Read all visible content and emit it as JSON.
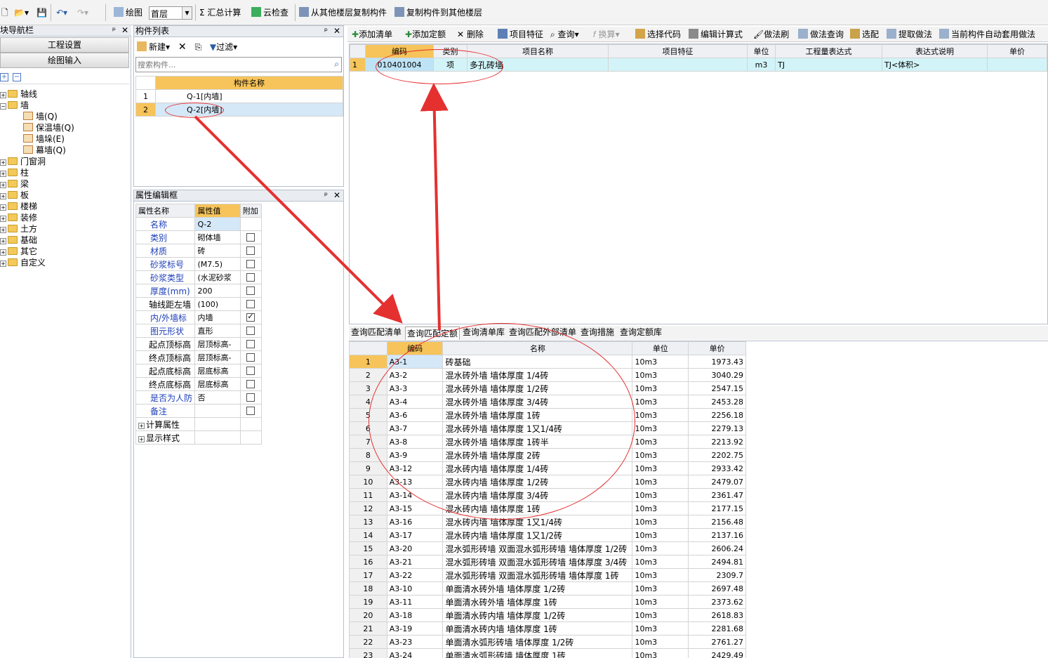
{
  "toolbar": {
    "draw_label": "绘图",
    "floor_value": "首层",
    "sum_label": "汇总计算",
    "cloud_label": "云检查",
    "copy_from_label": "从其他楼层复制构件",
    "copy_to_label": "复制构件到其他楼层"
  },
  "nav": {
    "title": "模块导航栏",
    "project_settings": "工程设置",
    "drawing_input": "绘图输入",
    "tree": [
      {
        "label": "轴线"
      },
      {
        "label": "墙"
      },
      {
        "label": "墙(Q)"
      },
      {
        "label": "保温墙(Q)"
      },
      {
        "label": "墙垛(E)"
      },
      {
        "label": "幕墙(Q)"
      },
      {
        "label": "门窗洞"
      },
      {
        "label": "柱"
      },
      {
        "label": "梁"
      },
      {
        "label": "板"
      },
      {
        "label": "楼梯"
      },
      {
        "label": "装修"
      },
      {
        "label": "土方"
      },
      {
        "label": "基础"
      },
      {
        "label": "其它"
      },
      {
        "label": "自定义"
      }
    ]
  },
  "complist": {
    "title": "构件列表",
    "new_label": "新建",
    "filter_label": "过滤",
    "search_placeholder": "搜索构件...",
    "col_name": "构件名称",
    "rows": [
      {
        "num": "1",
        "name": "Q-1[内墙]"
      },
      {
        "num": "2",
        "name": "Q-2[内墙]"
      }
    ]
  },
  "props": {
    "title": "属性编辑框",
    "col_name": "属性名称",
    "col_value": "属性值",
    "col_extra": "附加",
    "rows": [
      {
        "name": "名称",
        "value": "Q-2",
        "check": null
      },
      {
        "name": "类别",
        "value": "砌体墙",
        "check": false
      },
      {
        "name": "材质",
        "value": "砖",
        "check": false
      },
      {
        "name": "砂浆标号",
        "value": "(M7.5)",
        "check": false
      },
      {
        "name": "砂浆类型",
        "value": "(水泥砂浆",
        "check": false
      },
      {
        "name": "厚度(mm)",
        "value": "200",
        "check": false
      },
      {
        "name": "轴线距左墙",
        "value": "(100)",
        "check": false
      },
      {
        "name": "内/外墙标",
        "value": "内墙",
        "check": true
      },
      {
        "name": "图元形状",
        "value": "直形",
        "check": false
      },
      {
        "name": "起点顶标高",
        "value": "层顶标高-",
        "check": false
      },
      {
        "name": "终点顶标高",
        "value": "层顶标高-",
        "check": false
      },
      {
        "name": "起点底标高",
        "value": "层底标高",
        "check": false
      },
      {
        "name": "终点底标高",
        "value": "层底标高",
        "check": false
      },
      {
        "name": "是否为人防",
        "value": "否",
        "check": false
      },
      {
        "name": "备注",
        "value": "",
        "check": false
      }
    ],
    "group1": "计算属性",
    "group2": "显示样式"
  },
  "toolbar2": {
    "add_list": "添加清单",
    "add_quota": "添加定额",
    "delete": "删除",
    "feature": "项目特征",
    "query": "查询",
    "convert": "换算",
    "select_code": "选择代码",
    "edit_formula": "编辑计算式",
    "method_brush": "做法刷",
    "method_query": "做法查询",
    "select_match": "选配",
    "extract": "提取做法",
    "auto_apply": "当前构件自动套用做法"
  },
  "billgrid": {
    "headers": [
      "编码",
      "类别",
      "项目名称",
      "项目特征",
      "单位",
      "工程量表达式",
      "表达式说明",
      "单价"
    ],
    "row": {
      "num": "1",
      "code": "010401004",
      "type": "项",
      "name": "多孔砖墙",
      "feature": "",
      "unit": "m3",
      "expr": "TJ",
      "desc": "TJ<体积>",
      "price": ""
    }
  },
  "tabs": [
    "查询匹配清单",
    "查询匹配定额",
    "查询清单库",
    "查询匹配外部清单",
    "查询措施",
    "查询定额库"
  ],
  "quotagrid": {
    "headers": [
      "编码",
      "名称",
      "单位",
      "单价"
    ],
    "rows": [
      [
        "1",
        "A3-1",
        "砖基础",
        "10m3",
        "1973.43"
      ],
      [
        "2",
        "A3-2",
        "混水砖外墙 墙体厚度 1/4砖",
        "10m3",
        "3040.29"
      ],
      [
        "3",
        "A3-3",
        "混水砖外墙 墙体厚度 1/2砖",
        "10m3",
        "2547.15"
      ],
      [
        "4",
        "A3-4",
        "混水砖外墙 墙体厚度 3/4砖",
        "10m3",
        "2453.28"
      ],
      [
        "5",
        "A3-6",
        "混水砖外墙 墙体厚度 1砖",
        "10m3",
        "2256.18"
      ],
      [
        "6",
        "A3-7",
        "混水砖外墙 墙体厚度 1又1/4砖",
        "10m3",
        "2279.13"
      ],
      [
        "7",
        "A3-8",
        "混水砖外墙 墙体厚度 1砖半",
        "10m3",
        "2213.92"
      ],
      [
        "8",
        "A3-9",
        "混水砖外墙 墙体厚度 2砖",
        "10m3",
        "2202.75"
      ],
      [
        "9",
        "A3-12",
        "混水砖内墙 墙体厚度 1/4砖",
        "10m3",
        "2933.42"
      ],
      [
        "10",
        "A3-13",
        "混水砖内墙 墙体厚度 1/2砖",
        "10m3",
        "2479.07"
      ],
      [
        "11",
        "A3-14",
        "混水砖内墙 墙体厚度 3/4砖",
        "10m3",
        "2361.47"
      ],
      [
        "12",
        "A3-15",
        "混水砖内墙 墙体厚度 1砖",
        "10m3",
        "2177.15"
      ],
      [
        "13",
        "A3-16",
        "混水砖内墙 墙体厚度 1又1/4砖",
        "10m3",
        "2156.48"
      ],
      [
        "14",
        "A3-17",
        "混水砖内墙 墙体厚度 1又1/2砖",
        "10m3",
        "2137.16"
      ],
      [
        "15",
        "A3-20",
        "混水弧形砖墙 双面混水弧形砖墙 墙体厚度 1/2砖",
        "10m3",
        "2606.24"
      ],
      [
        "16",
        "A3-21",
        "混水弧形砖墙 双面混水弧形砖墙 墙体厚度 3/4砖",
        "10m3",
        "2494.81"
      ],
      [
        "17",
        "A3-22",
        "混水弧形砖墙 双面混水弧形砖墙 墙体厚度 1砖",
        "10m3",
        "2309.7"
      ],
      [
        "18",
        "A3-10",
        "单面清水砖外墙 墙体厚度 1/2砖",
        "10m3",
        "2697.48"
      ],
      [
        "19",
        "A3-11",
        "单面清水砖外墙 墙体厚度 1砖",
        "10m3",
        "2373.62"
      ],
      [
        "20",
        "A3-18",
        "单面清水砖内墙 墙体厚度 1/2砖",
        "10m3",
        "2618.83"
      ],
      [
        "21",
        "A3-19",
        "单面清水砖内墙 墙体厚度 1砖",
        "10m3",
        "2281.68"
      ],
      [
        "22",
        "A3-23",
        "单面清水弧形砖墙 墙体厚度 1/2砖",
        "10m3",
        "2761.27"
      ],
      [
        "23",
        "A3-24",
        "单面清水弧形砖墙 墙体厚度 1砖",
        "10m3",
        "2429.49"
      ]
    ]
  },
  "colors": {
    "accent": "#f6c45a",
    "selected_row": "#d5e8f8",
    "annotation": "#e53030"
  }
}
